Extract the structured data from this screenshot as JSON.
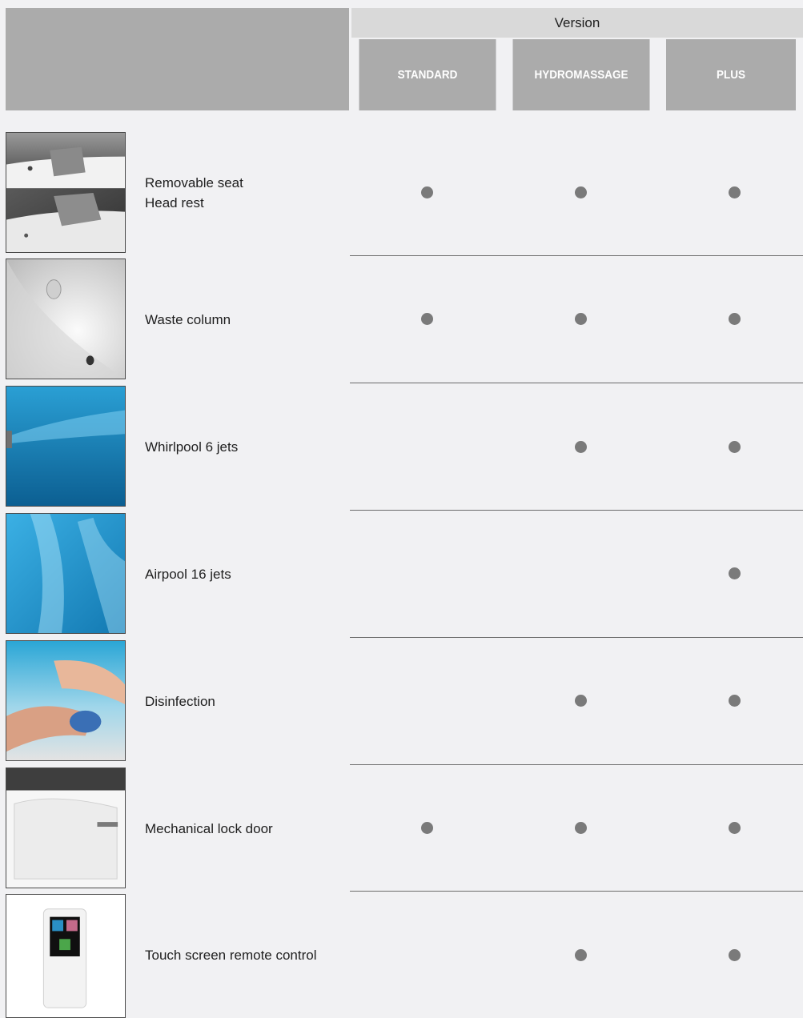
{
  "header": {
    "version_label": "Version",
    "columns": [
      "STANDARD",
      "HYDROMASSAGE",
      "PLUS"
    ]
  },
  "features": [
    {
      "label_lines": [
        "Removable seat",
        "Head rest"
      ],
      "thumbnail": "removable-seat-photo",
      "standard": true,
      "hydromassage": true,
      "plus": true
    },
    {
      "label_lines": [
        "Waste column"
      ],
      "thumbnail": "waste-column-photo",
      "standard": true,
      "hydromassage": true,
      "plus": true
    },
    {
      "label_lines": [
        "Whirlpool 6 jets"
      ],
      "thumbnail": "whirlpool-jets-photo",
      "standard": false,
      "hydromassage": true,
      "plus": true
    },
    {
      "label_lines": [
        "Airpool 16 jets"
      ],
      "thumbnail": "airpool-jets-photo",
      "standard": false,
      "hydromassage": false,
      "plus": true
    },
    {
      "label_lines": [
        "Disinfection"
      ],
      "thumbnail": "disinfection-photo",
      "standard": false,
      "hydromassage": true,
      "plus": true
    },
    {
      "label_lines": [
        "Mechanical lock door"
      ],
      "thumbnail": "lock-door-photo",
      "standard": true,
      "hydromassage": true,
      "plus": true
    },
    {
      "label_lines": [
        "Touch screen remote control"
      ],
      "thumbnail": "remote-control-photo",
      "standard": false,
      "hydromassage": true,
      "plus": true
    }
  ],
  "colors": {
    "header_dark": "#ababab",
    "header_light": "#d9d9d9",
    "background": "#f1f1f3",
    "dot": "#7a7a7a"
  }
}
